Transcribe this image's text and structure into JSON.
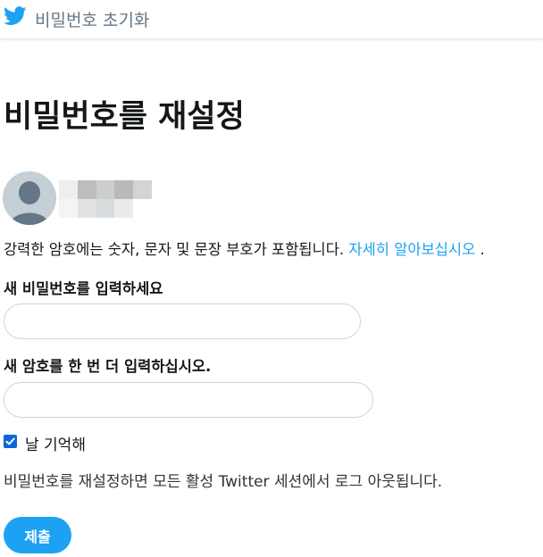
{
  "header": {
    "logo_icon": "twitter-bird-icon",
    "title": "비밀번호 초기화"
  },
  "page": {
    "heading": "비밀번호를 재설정"
  },
  "account": {
    "avatar_icon": "default-avatar-icon"
  },
  "password_hint": {
    "text": "강력한 암호에는 숫자, 문자 및 문장 부호가 포함됩니다. ",
    "link": "자세히 알아보십시오",
    "suffix": " ."
  },
  "form": {
    "new_password_label": "새 비밀번호를 입력하세요",
    "new_password_value": "",
    "confirm_password_label": "새 암호를 한 번 더 입력하십시오.",
    "confirm_password_value": "",
    "remember_label": "날 기억해",
    "remember_checked": true,
    "notice": "비밀번호를 재설정하면 모든 활성 Twitter 세션에서 로그 아웃됩니다.",
    "submit_label": "제출"
  },
  "colors": {
    "brand": "#1da1f2",
    "checkbox": "#0a66d6",
    "muted": "#657786"
  }
}
